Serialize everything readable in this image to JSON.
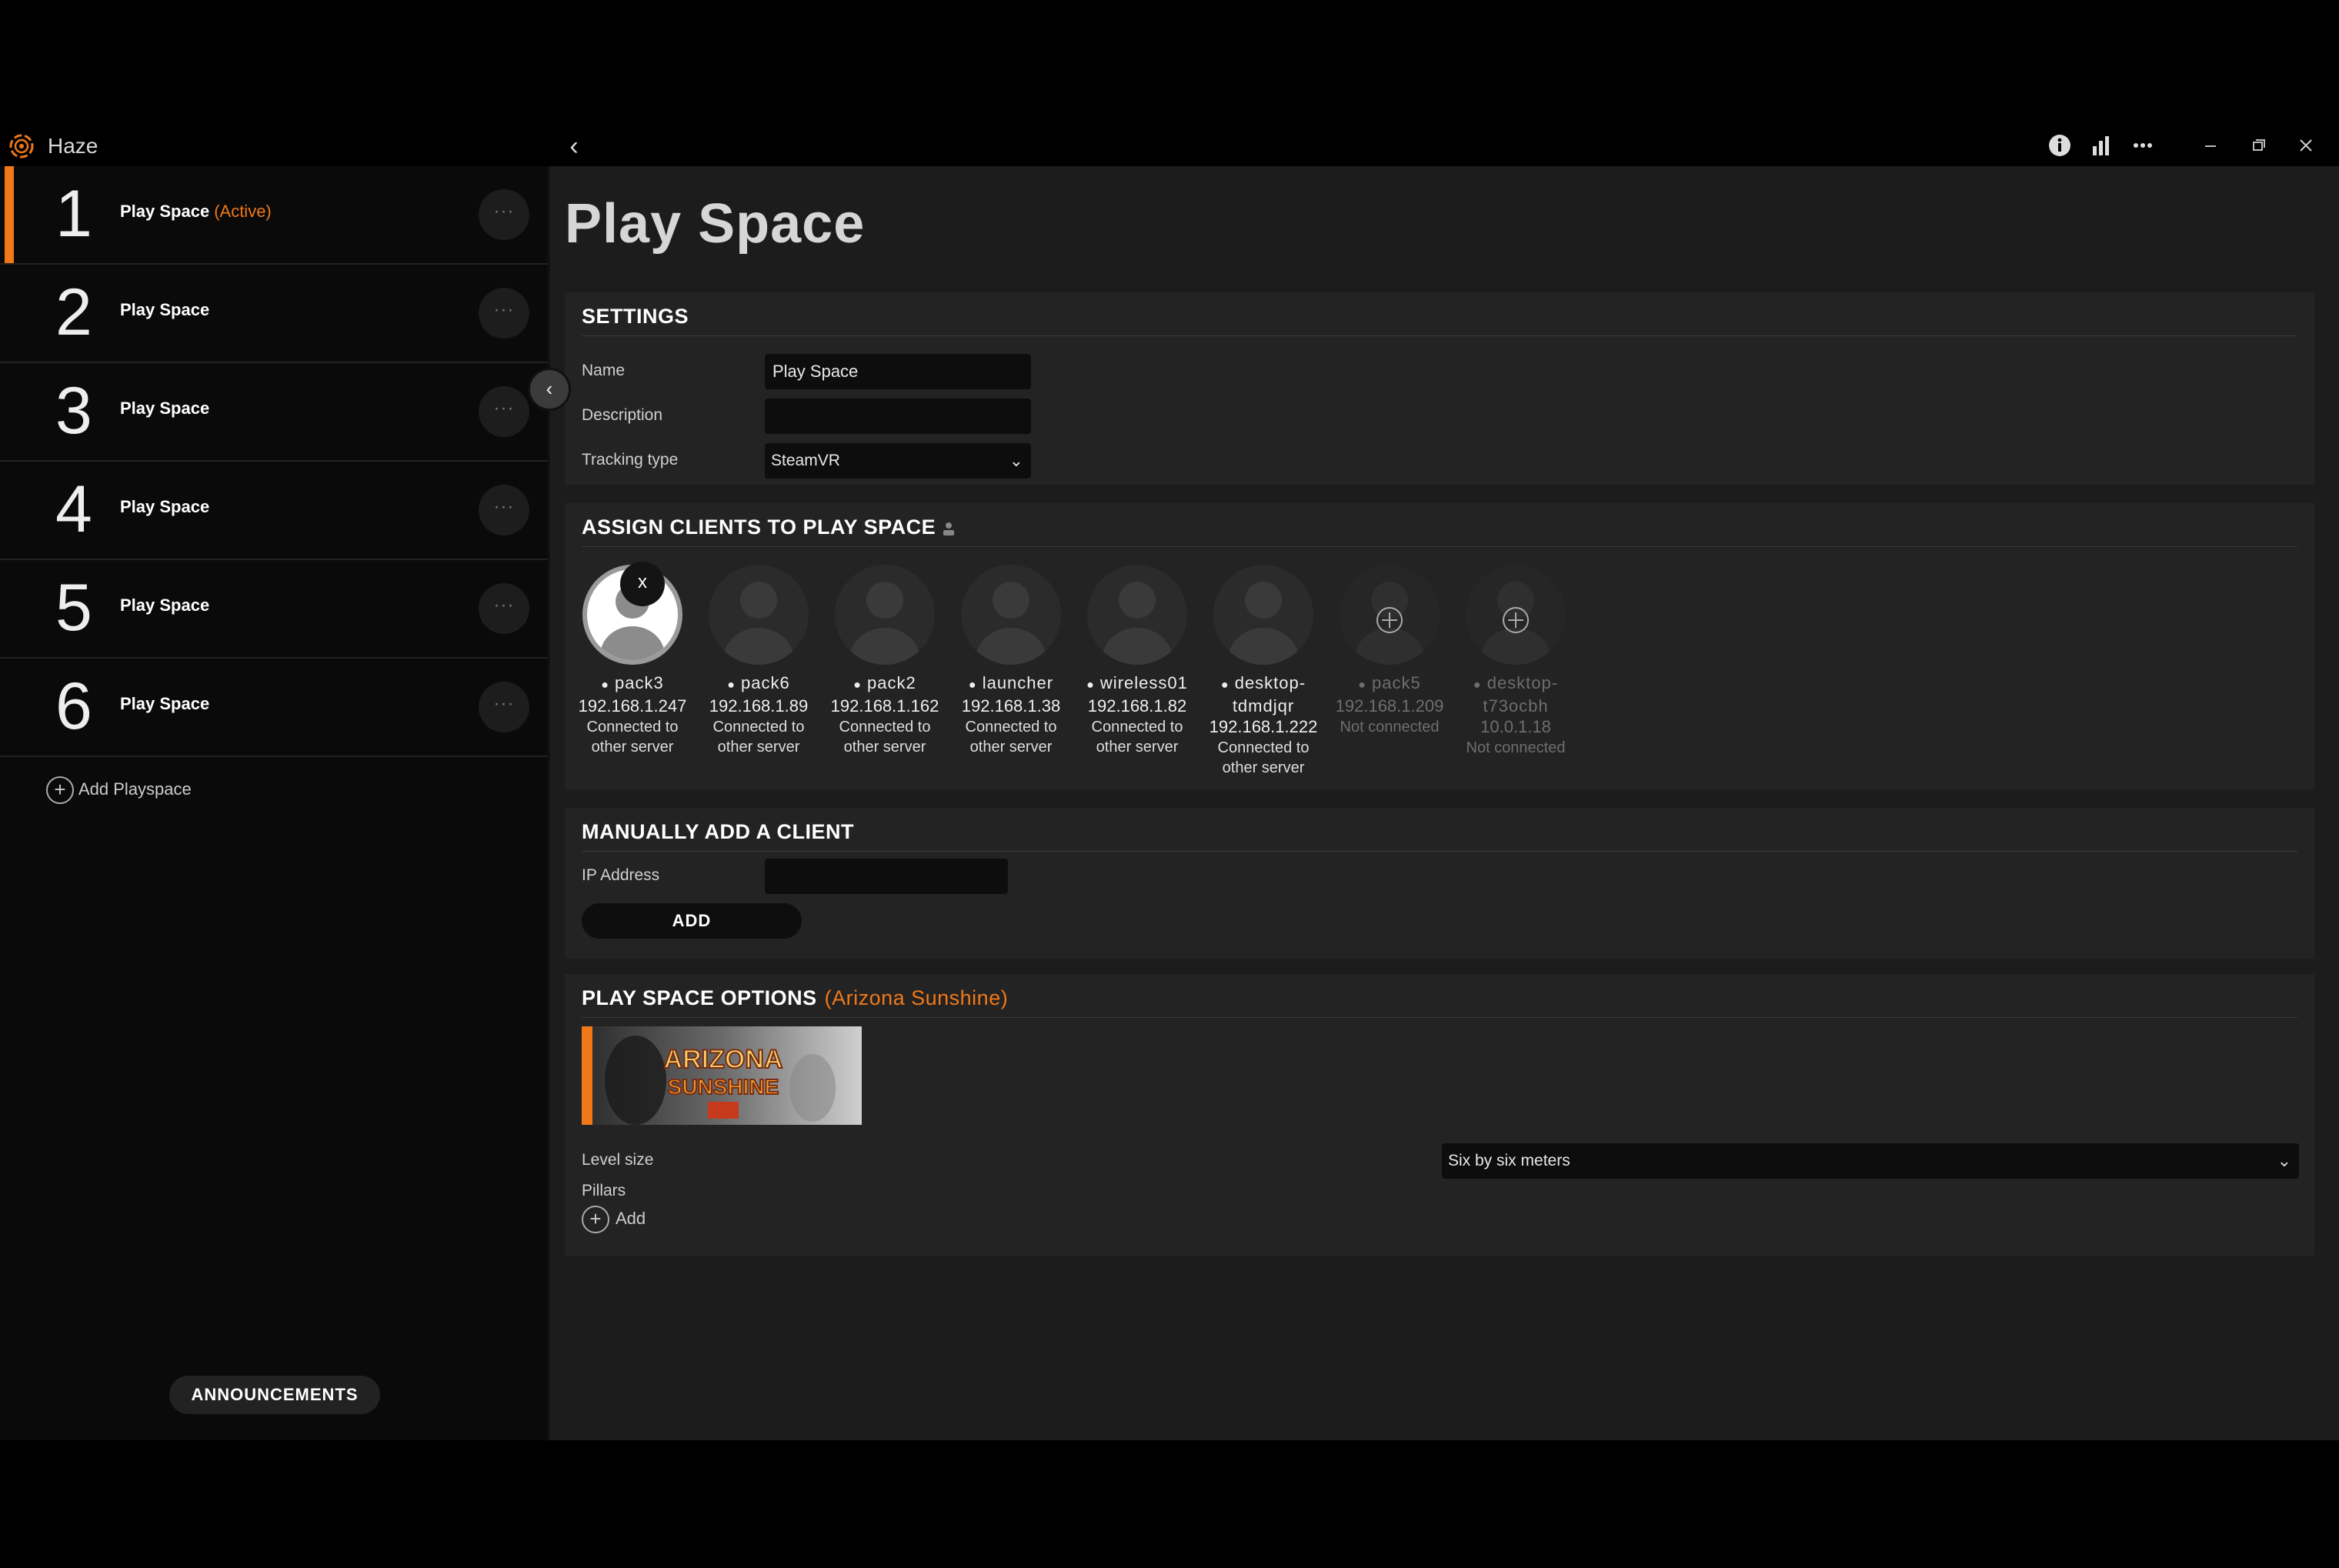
{
  "app": {
    "title": "Haze"
  },
  "colors": {
    "accent": "#f07819",
    "sidebar_bg": "#0a0a0a",
    "main_bg": "#1c1c1c",
    "section_bg": "#232323"
  },
  "titlebar": {
    "icons": [
      "info-icon",
      "stats-icon",
      "more-icon",
      "minimize-icon",
      "restore-icon",
      "close-icon"
    ]
  },
  "sidebar": {
    "playspaces": [
      {
        "number": "1",
        "label": "Play Space",
        "status": "(Active)"
      },
      {
        "number": "2",
        "label": "Play Space",
        "status": ""
      },
      {
        "number": "3",
        "label": "Play Space",
        "status": ""
      },
      {
        "number": "4",
        "label": "Play Space",
        "status": ""
      },
      {
        "number": "5",
        "label": "Play Space",
        "status": ""
      },
      {
        "number": "6",
        "label": "Play Space",
        "status": ""
      }
    ],
    "more_label": "···",
    "add_label": "Add Playspace",
    "announcements_label": "ANNOUNCEMENTS"
  },
  "main": {
    "title": "Play Space",
    "settings": {
      "title": "SETTINGS",
      "name_label": "Name",
      "name_value": "Play Space",
      "description_label": "Description",
      "description_value": "",
      "tracking_label": "Tracking type",
      "tracking_value": "SteamVR"
    },
    "assign": {
      "title": "ASSIGN CLIENTS TO PLAY SPACE",
      "remove_label": "x",
      "clients": [
        {
          "name": "pack3",
          "ip": "192.168.1.247",
          "status": "Connected to other server"
        },
        {
          "name": "pack6",
          "ip": "192.168.1.89",
          "status": "Connected to other server"
        },
        {
          "name": "pack2",
          "ip": "192.168.1.162",
          "status": "Connected to other server"
        },
        {
          "name": "launcher",
          "ip": "192.168.1.38",
          "status": "Connected to other server"
        },
        {
          "name": "wireless01",
          "ip": "192.168.1.82",
          "status": "Connected to other server"
        },
        {
          "name": "desktop-tdmdjqr",
          "ip": "192.168.1.222",
          "status": "Connected to other server"
        },
        {
          "name": "pack5",
          "ip": "192.168.1.209",
          "status": "Not connected"
        },
        {
          "name": "desktop-t73ocbh",
          "ip": "10.0.1.18",
          "status": "Not connected"
        }
      ]
    },
    "manual": {
      "title": "MANUALLY ADD A CLIENT",
      "ip_label": "IP Address",
      "ip_value": "",
      "add_button": "ADD"
    },
    "options": {
      "title": "PLAY SPACE OPTIONS",
      "game": "(Arizona Sunshine)",
      "thumb_text_1": "ARIZONA",
      "thumb_text_2": "SUNSHINE",
      "level_size_label": "Level size",
      "level_size_value": "Six by six meters",
      "pillars_label": "Pillars",
      "add_label": "Add"
    }
  }
}
